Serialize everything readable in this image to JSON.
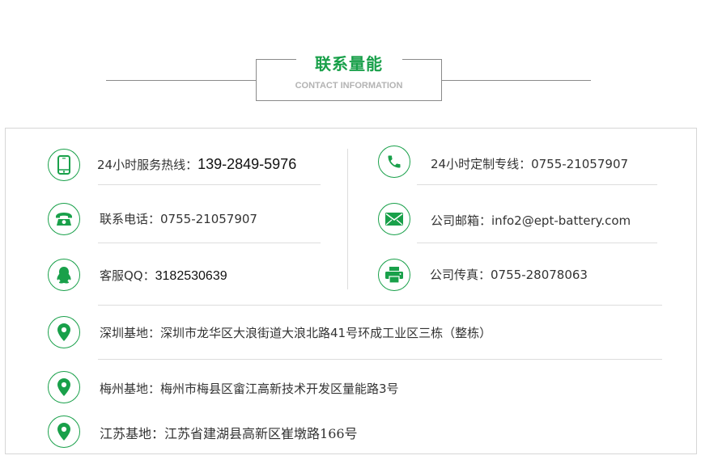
{
  "header": {
    "title": "联系量能",
    "subtitle": "CONTACT INFORMATION"
  },
  "colors": {
    "accent": "#19a04a",
    "text": "#333333",
    "divider": "#dddddd"
  },
  "contacts": {
    "hotline": {
      "icon": "mobile-phone-icon",
      "label": "24小时服务热线：",
      "value": "139-2849-5976"
    },
    "custom_line": {
      "icon": "phone-handset-icon",
      "label": "24小时定制专线：",
      "value": "0755-21057907"
    },
    "phone": {
      "icon": "telephone-icon",
      "label": "联系电话：",
      "value": "0755-21057907"
    },
    "email": {
      "icon": "envelope-icon",
      "label": "公司邮箱：",
      "value": "info2@ept-battery.com"
    },
    "qq": {
      "icon": "qq-penguin-icon",
      "label": "客服QQ：",
      "value": "3182530639"
    },
    "fax": {
      "icon": "printer-icon",
      "label": "公司传真：",
      "value": "0755-28078063"
    }
  },
  "bases": [
    {
      "icon": "location-pin-icon",
      "label": "深圳基地：",
      "value": "深圳市龙华区大浪街道大浪北路41号环成工业区三栋（整栋）"
    },
    {
      "icon": "location-pin-icon",
      "label": "梅州基地：",
      "value": "梅州市梅县区畲江高新技术开发区量能路3号"
    },
    {
      "icon": "location-pin-icon",
      "label": "江苏基地：",
      "value": "江苏省建湖县高新区崔墩路166号"
    }
  ]
}
